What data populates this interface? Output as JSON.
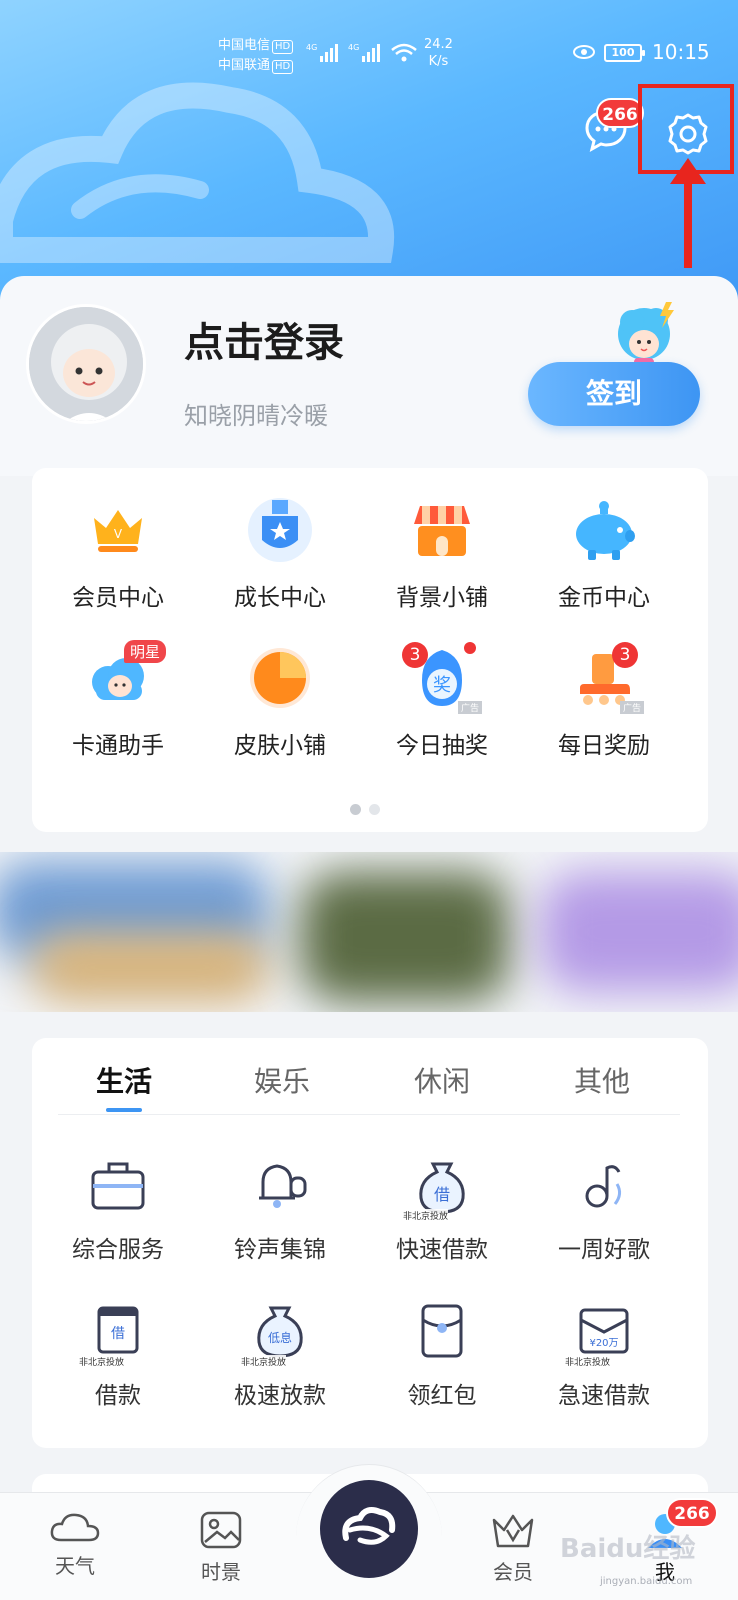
{
  "status_bar": {
    "carrier1": "中国电信",
    "carrier2": "中国联通",
    "hd": "HD",
    "net": "4G",
    "speed_value": "24.2",
    "speed_unit": "K/s",
    "battery": "100",
    "time": "10:15"
  },
  "header": {
    "message_badge": "266"
  },
  "profile": {
    "login_title": "点击登录",
    "subtitle": "知晓阴晴冷暖",
    "signin_label": "签到"
  },
  "grid": {
    "items": [
      {
        "label": "会员中心",
        "icon": "crown-icon"
      },
      {
        "label": "成长中心",
        "icon": "medal-icon"
      },
      {
        "label": "背景小铺",
        "icon": "shop-icon"
      },
      {
        "label": "金币中心",
        "icon": "piggy-bank-icon"
      },
      {
        "label": "卡通助手",
        "icon": "cartoon-cloud-icon",
        "badge": "明星"
      },
      {
        "label": "皮肤小铺",
        "icon": "pie-icon"
      },
      {
        "label": "今日抽奖",
        "icon": "lottery-icon",
        "badge": "3",
        "glyph": "奖"
      },
      {
        "label": "每日奖励",
        "icon": "skate-icon",
        "badge": "3"
      }
    ],
    "ad_tag": "广告"
  },
  "tabs": {
    "labels": [
      "生活",
      "娱乐",
      "休闲",
      "其他"
    ],
    "active_index": 0,
    "items": [
      {
        "label": "综合服务",
        "icon": "briefcase-icon"
      },
      {
        "label": "铃声集锦",
        "icon": "bell-icon"
      },
      {
        "label": "快速借款",
        "icon": "money-bag-icon",
        "glyph": "借",
        "sub": "非北京投放"
      },
      {
        "label": "一周好歌",
        "icon": "music-note-icon"
      },
      {
        "label": "借款",
        "icon": "loan-card-icon",
        "glyph": "借",
        "sub": "非北京投放"
      },
      {
        "label": "极速放款",
        "icon": "low-interest-bag-icon",
        "glyph": "低息",
        "sub": "非北京投放"
      },
      {
        "label": "领红包",
        "icon": "red-envelope-icon"
      },
      {
        "label": "急速借款",
        "icon": "envelope-icon",
        "glyph": "¥20万",
        "sub": "非北京投放"
      }
    ]
  },
  "nav": {
    "items": [
      "天气",
      "时景",
      "会员",
      "我"
    ],
    "badge": "266"
  },
  "watermark": {
    "main": "Baidu经验",
    "sub": "jingyan.baidu.com"
  },
  "colors": {
    "accent": "#3d95f3",
    "badge": "#f23b3b",
    "highlight": "#e8251e"
  }
}
